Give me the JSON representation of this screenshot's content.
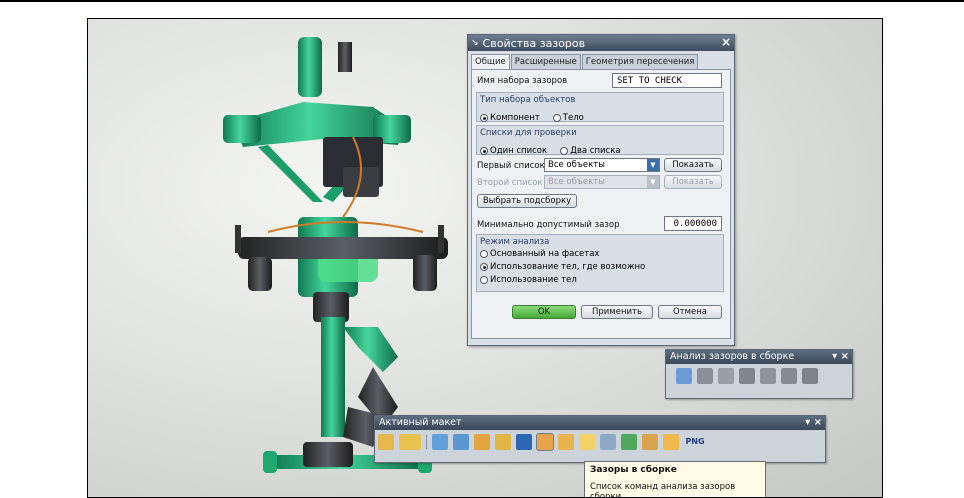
{
  "dialog": {
    "title": "Свойства зазоров",
    "close": "×",
    "tabs": [
      "Общие",
      "Расширенные",
      "Геометрия пересечения"
    ],
    "set_name_label": "Имя набора зазоров",
    "set_name_value": "SET TO CHECK",
    "object_type": {
      "title": "Тип набора объектов",
      "options": [
        "Компонент",
        "Тело"
      ],
      "selected": "Компонент"
    },
    "check_lists": {
      "title": "Списки для проверки",
      "options": [
        "Один список",
        "Два списка"
      ],
      "selected": "Один список"
    },
    "first_list_label": "Первый список",
    "first_list_value": "Все объекты",
    "second_list_label": "Второй список",
    "second_list_value": "Все объекты",
    "show_label": "Показать",
    "select_subassembly": "Выбрать подсборку",
    "min_clearance_label": "Минимально допустимый зазор",
    "min_clearance_value": "0.000000",
    "analysis_mode": {
      "title": "Режим анализа",
      "options": [
        "Основанный на фасетах",
        "Использование тел, где возможно",
        "Использование тел"
      ],
      "selected": "Использование тел, где возможно"
    },
    "ok": "OK",
    "apply": "Применить",
    "cancel": "Отмена"
  },
  "clearance_toolbar": {
    "title": "Анализ зазоров в сборке",
    "controls": "▾ ×",
    "icons": [
      "clearance-set-icon",
      "run-analysis-icon",
      "edit-set-icon",
      "new-set-icon",
      "compare-icon",
      "report-icon",
      "export-icon"
    ]
  },
  "active_toolbar": {
    "title": "Активный макет",
    "controls": "▾ ×",
    "png_label": "PNG"
  },
  "tooltip": {
    "title": "Зазоры в сборке",
    "text": "Список команд анализа зазоров сборки."
  },
  "colors": {
    "model_green": "#2fbf8a",
    "model_dark": "#3a3f45",
    "dialog_bg": "#d9dfe6",
    "title_bar": "#4a5a6c"
  }
}
